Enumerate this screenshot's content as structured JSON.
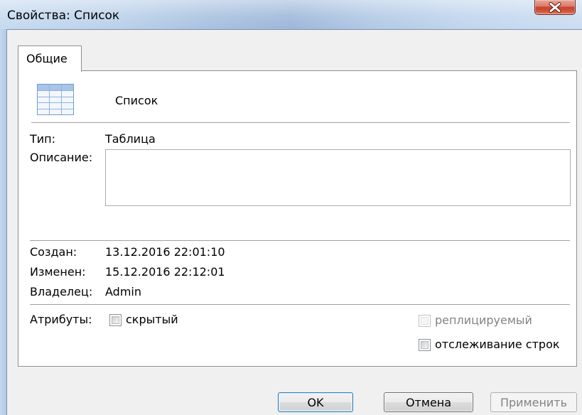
{
  "window": {
    "title": "Свойства: Список"
  },
  "tabs": [
    {
      "label": "Общие",
      "active": true
    }
  ],
  "object": {
    "icon": "table-icon",
    "name": "Список"
  },
  "fields": {
    "type_label": "Тип:",
    "type_value": "Таблица",
    "description_label": "Описание:",
    "description_value": "",
    "created_label": "Создан:",
    "created_value": "13.12.2016 22:01:10",
    "modified_label": "Изменен:",
    "modified_value": "15.12.2016 22:12:01",
    "owner_label": "Владелец:",
    "owner_value": "Admin"
  },
  "attributes": {
    "label": "Атрибуты:",
    "hidden": {
      "label": "скрытый",
      "checked": false,
      "enabled": true
    },
    "replicated": {
      "label": "реплицируемый",
      "checked": false,
      "enabled": false
    },
    "row_tracking": {
      "label": "отслеживание строк",
      "checked": false,
      "enabled": true
    }
  },
  "buttons": {
    "ok": {
      "label": "OK",
      "enabled": true,
      "default": true
    },
    "cancel": {
      "label": "Отмена",
      "enabled": true
    },
    "apply": {
      "label": "Применить",
      "enabled": false
    }
  },
  "icons": {
    "close": "close-icon",
    "object": "table-icon"
  },
  "colors": {
    "close_button": "#c7412c",
    "default_button_border": "#3c7fb1",
    "disabled_text": "#838383",
    "icon_accent": "#6f9bd1"
  }
}
